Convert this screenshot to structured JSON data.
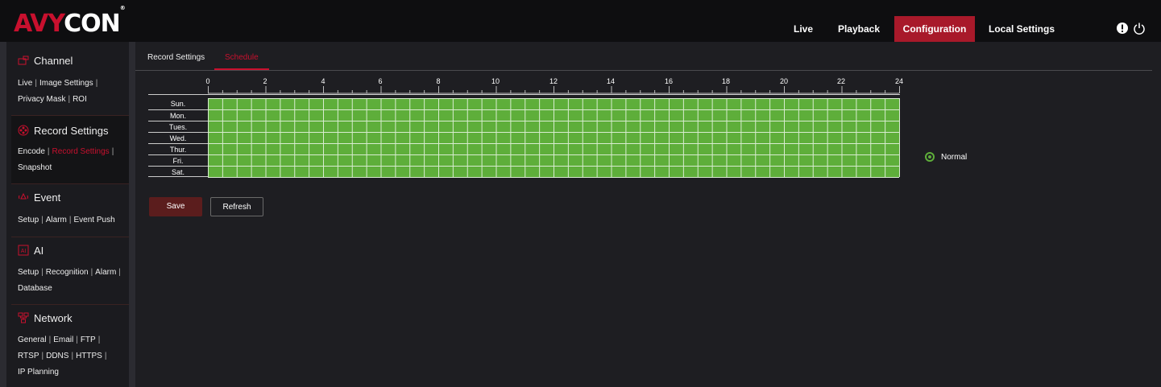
{
  "brand": {
    "logo_part1": "AVY",
    "logo_part2": "CON",
    "trademark": "®"
  },
  "nav": {
    "items": [
      {
        "label": "Live"
      },
      {
        "label": "Playback"
      },
      {
        "label": "Configuration"
      },
      {
        "label": "Local Settings"
      }
    ],
    "active": "Configuration"
  },
  "header_icons": [
    "info-icon",
    "power-icon"
  ],
  "sidebar": {
    "sections": [
      {
        "title": "Channel",
        "icon": "channel-icon",
        "links": [
          "Live",
          "Image Settings",
          "Privacy Mask",
          "ROI"
        ]
      },
      {
        "title": "Record Settings",
        "icon": "record-icon",
        "links": [
          "Encode",
          "Record Settings",
          "Snapshot"
        ],
        "active_link": "Record Settings"
      },
      {
        "title": "Event",
        "icon": "event-icon",
        "links": [
          "Setup",
          "Alarm",
          "Event Push"
        ]
      },
      {
        "title": "AI",
        "icon": "ai-icon",
        "links": [
          "Setup",
          "Recognition",
          "Alarm",
          "Database"
        ]
      },
      {
        "title": "Network",
        "icon": "network-icon",
        "links": [
          "General",
          "Email",
          "FTP",
          "RTSP",
          "DDNS",
          "HTTPS",
          "IP Planning"
        ]
      }
    ]
  },
  "tabs": [
    {
      "label": "Record Settings"
    },
    {
      "label": "Schedule"
    }
  ],
  "active_tab": "Schedule",
  "schedule": {
    "hour_labels": [
      "0",
      "2",
      "4",
      "6",
      "8",
      "10",
      "12",
      "14",
      "16",
      "18",
      "20",
      "22",
      "24"
    ],
    "days": [
      "Sun.",
      "Mon.",
      "Tues.",
      "Wed.",
      "Thur.",
      "Fri.",
      "Sat."
    ],
    "legend_label": "Normal",
    "colors": {
      "normal": "#5eae3a"
    }
  },
  "buttons": {
    "save_label": "Save",
    "refresh_label": "Refresh"
  },
  "colors": {
    "accent": "#c8102e",
    "active_nav": "#a8192a",
    "schedule_green": "#5eae3a"
  }
}
